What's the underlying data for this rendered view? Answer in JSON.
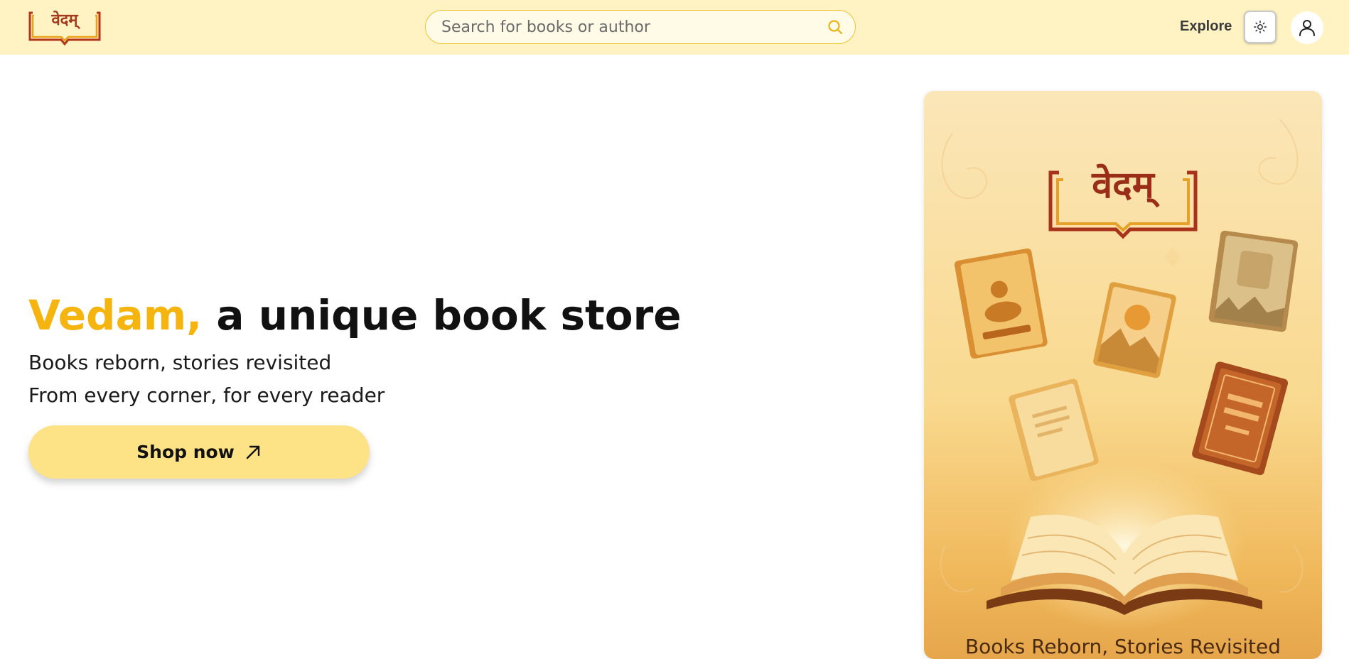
{
  "header": {
    "logo_text": "वेदम्",
    "search": {
      "placeholder": "Search for books or author",
      "value": ""
    },
    "explore_label": "Explore",
    "theme_icon": "sun-icon",
    "user_icon": "user-icon"
  },
  "hero": {
    "title_accent": "Vedam,",
    "title_rest": "a unique book store",
    "line1": "Books reborn, stories revisited",
    "line2": "From every corner, for every reader",
    "cta_label": "Shop now",
    "cta_icon": "arrow-up-right-icon"
  },
  "promo": {
    "logo_text": "वेदम्",
    "caption": "Books Reborn, Stories Revisited"
  },
  "colors": {
    "header_bg": "#fff3c4",
    "accent": "#f5b50e",
    "cta_bg": "#fde286",
    "search_border": "#f2c230"
  }
}
